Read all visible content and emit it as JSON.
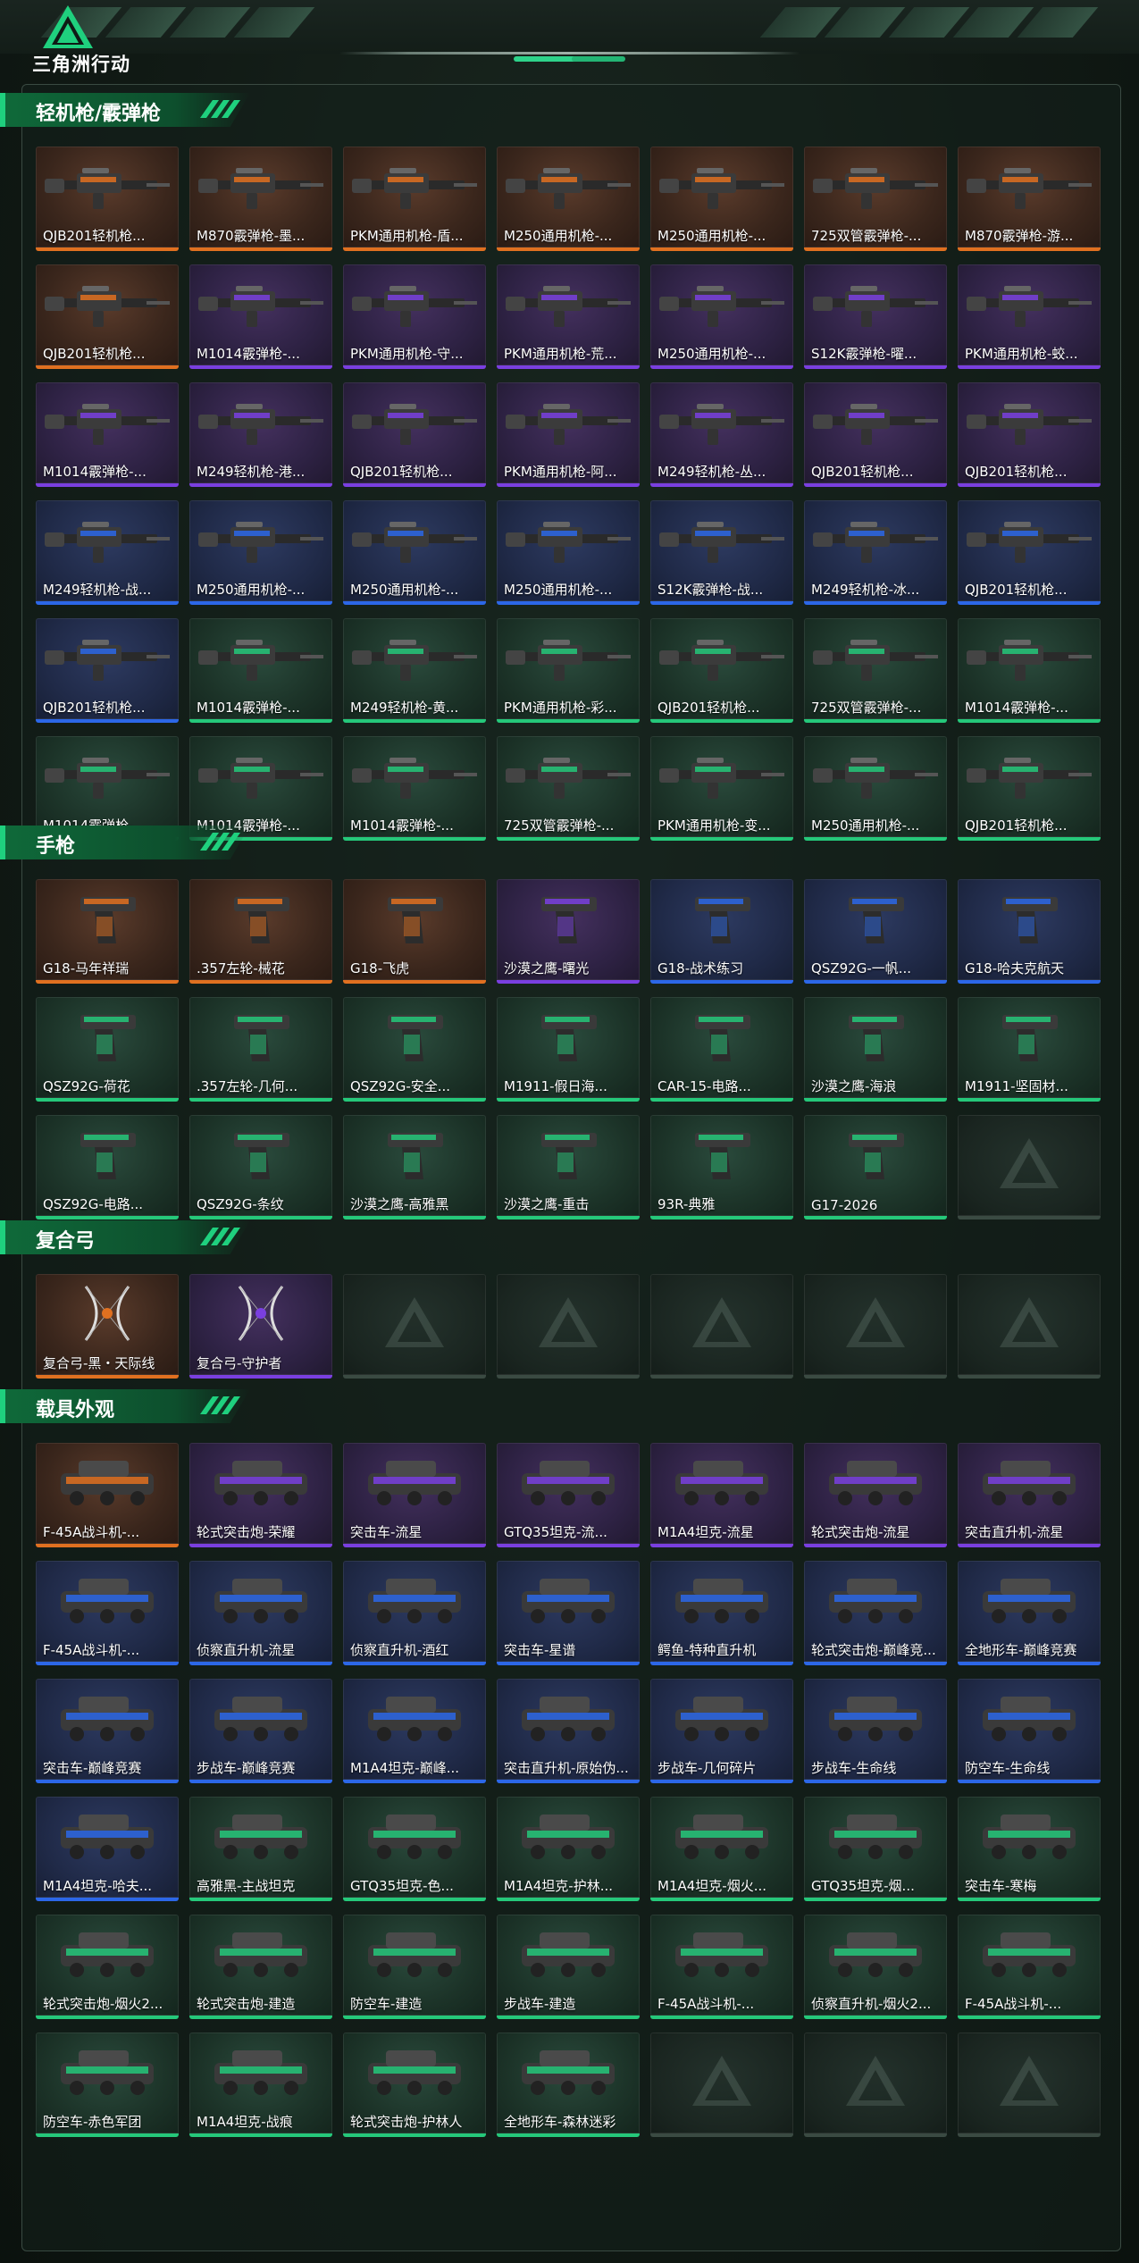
{
  "brand": {
    "name": "三角洲行动",
    "accent": "#1fd07e"
  },
  "colors": {
    "orange": "#e07020",
    "purple": "#7a3fe0",
    "blue": "#2c67e8",
    "green": "#25c87a"
  },
  "sections": [
    {
      "title": "轻机枪/霰弹枪",
      "kind": "gun",
      "items": [
        {
          "label": "QJB201轻机枪...",
          "rarity": "orange"
        },
        {
          "label": "M870霰弹枪-墨...",
          "rarity": "orange"
        },
        {
          "label": "PKM通用机枪-盾...",
          "rarity": "orange"
        },
        {
          "label": "M250通用机枪-...",
          "rarity": "orange"
        },
        {
          "label": "M250通用机枪-...",
          "rarity": "orange"
        },
        {
          "label": "725双管霰弹枪-...",
          "rarity": "orange"
        },
        {
          "label": "M870霰弹枪-游...",
          "rarity": "orange"
        },
        {
          "label": "QJB201轻机枪...",
          "rarity": "orange"
        },
        {
          "label": "M1014霰弹枪-...",
          "rarity": "purple"
        },
        {
          "label": "PKM通用机枪-守...",
          "rarity": "purple"
        },
        {
          "label": "PKM通用机枪-荒...",
          "rarity": "purple"
        },
        {
          "label": "M250通用机枪-...",
          "rarity": "purple"
        },
        {
          "label": "S12K霰弹枪-曜...",
          "rarity": "purple"
        },
        {
          "label": "PKM通用机枪-蛟...",
          "rarity": "purple"
        },
        {
          "label": "M1014霰弹枪-...",
          "rarity": "purple"
        },
        {
          "label": "M249轻机枪-港...",
          "rarity": "purple"
        },
        {
          "label": "QJB201轻机枪...",
          "rarity": "purple"
        },
        {
          "label": "PKM通用机枪-阿...",
          "rarity": "purple"
        },
        {
          "label": "M249轻机枪-丛...",
          "rarity": "purple"
        },
        {
          "label": "QJB201轻机枪...",
          "rarity": "purple"
        },
        {
          "label": "QJB201轻机枪...",
          "rarity": "purple"
        },
        {
          "label": "M249轻机枪-战...",
          "rarity": "blue"
        },
        {
          "label": "M250通用机枪-...",
          "rarity": "blue"
        },
        {
          "label": "M250通用机枪-...",
          "rarity": "blue"
        },
        {
          "label": "M250通用机枪-...",
          "rarity": "blue"
        },
        {
          "label": "S12K霰弹枪-战...",
          "rarity": "blue"
        },
        {
          "label": "M249轻机枪-冰...",
          "rarity": "blue"
        },
        {
          "label": "QJB201轻机枪...",
          "rarity": "blue"
        },
        {
          "label": "QJB201轻机枪...",
          "rarity": "blue"
        },
        {
          "label": "M1014霰弹枪-...",
          "rarity": "green"
        },
        {
          "label": "M249轻机枪-黄...",
          "rarity": "green"
        },
        {
          "label": "PKM通用机枪-彩...",
          "rarity": "green"
        },
        {
          "label": "QJB201轻机枪...",
          "rarity": "green"
        },
        {
          "label": "725双管霰弹枪-...",
          "rarity": "green"
        },
        {
          "label": "M1014霰弹枪-...",
          "rarity": "green"
        },
        {
          "label": "M1014霰弹枪-...",
          "rarity": "green"
        },
        {
          "label": "M1014霰弹枪-...",
          "rarity": "green"
        },
        {
          "label": "M1014霰弹枪-...",
          "rarity": "green"
        },
        {
          "label": "725双管霰弹枪-...",
          "rarity": "green"
        },
        {
          "label": "PKM通用机枪-变...",
          "rarity": "green"
        },
        {
          "label": "M250通用机枪-...",
          "rarity": "green"
        },
        {
          "label": "QJB201轻机枪...",
          "rarity": "green"
        }
      ]
    },
    {
      "title": "手枪",
      "kind": "pistol",
      "items": [
        {
          "label": "G18-马年祥瑞",
          "rarity": "orange"
        },
        {
          "label": ".357左轮-械花",
          "rarity": "orange"
        },
        {
          "label": "G18-飞虎",
          "rarity": "orange"
        },
        {
          "label": "沙漠之鹰-曙光",
          "rarity": "purple"
        },
        {
          "label": "G18-战术练习",
          "rarity": "blue"
        },
        {
          "label": "QSZ92G-一帆...",
          "rarity": "blue"
        },
        {
          "label": "G18-哈夫克航天",
          "rarity": "blue"
        },
        {
          "label": "QSZ92G-荷花",
          "rarity": "green"
        },
        {
          "label": ".357左轮-几何...",
          "rarity": "green"
        },
        {
          "label": "QSZ92G-安全...",
          "rarity": "green"
        },
        {
          "label": "M1911-假日海...",
          "rarity": "green"
        },
        {
          "label": "CAR-15-电路...",
          "rarity": "green"
        },
        {
          "label": "沙漠之鹰-海浪",
          "rarity": "green"
        },
        {
          "label": "M1911-坚固材...",
          "rarity": "green"
        },
        {
          "label": "QSZ92G-电路...",
          "rarity": "green"
        },
        {
          "label": "QSZ92G-条纹",
          "rarity": "green"
        },
        {
          "label": "沙漠之鹰-高雅黑",
          "rarity": "green"
        },
        {
          "label": "沙漠之鹰-重击",
          "rarity": "green"
        },
        {
          "label": "93R-典雅",
          "rarity": "green"
        },
        {
          "label": "G17-2026",
          "rarity": "green"
        },
        {
          "label": "",
          "rarity": "empty"
        }
      ]
    },
    {
      "title": "复合弓",
      "kind": "bow",
      "items": [
        {
          "label": "复合弓-黑・天际线",
          "rarity": "orange"
        },
        {
          "label": "复合弓-守护者",
          "rarity": "purple"
        },
        {
          "label": "",
          "rarity": "empty"
        },
        {
          "label": "",
          "rarity": "empty"
        },
        {
          "label": "",
          "rarity": "empty"
        },
        {
          "label": "",
          "rarity": "empty"
        },
        {
          "label": "",
          "rarity": "empty"
        }
      ]
    },
    {
      "title": "载具外观",
      "kind": "vehicle",
      "items": [
        {
          "label": "F-45A战斗机-...",
          "rarity": "orange"
        },
        {
          "label": "轮式突击炮-荣耀",
          "rarity": "purple"
        },
        {
          "label": "突击车-流星",
          "rarity": "purple"
        },
        {
          "label": "GTQ35坦克-流...",
          "rarity": "purple"
        },
        {
          "label": "M1A4坦克-流星",
          "rarity": "purple"
        },
        {
          "label": "轮式突击炮-流星",
          "rarity": "purple"
        },
        {
          "label": "突击直升机-流星",
          "rarity": "purple"
        },
        {
          "label": "F-45A战斗机-...",
          "rarity": "blue"
        },
        {
          "label": "侦察直升机-流星",
          "rarity": "blue"
        },
        {
          "label": "侦察直升机-酒红",
          "rarity": "blue"
        },
        {
          "label": "突击车-星谱",
          "rarity": "blue"
        },
        {
          "label": "鳄鱼-特种直升机",
          "rarity": "blue"
        },
        {
          "label": "轮式突击炮-巅峰竞...",
          "rarity": "blue"
        },
        {
          "label": "全地形车-巅峰竞赛",
          "rarity": "blue"
        },
        {
          "label": "突击车-巅峰竞赛",
          "rarity": "blue"
        },
        {
          "label": "步战车-巅峰竞赛",
          "rarity": "blue"
        },
        {
          "label": "M1A4坦克-巅峰...",
          "rarity": "blue"
        },
        {
          "label": "突击直升机-原始伪...",
          "rarity": "blue"
        },
        {
          "label": "步战车-几何碎片",
          "rarity": "blue"
        },
        {
          "label": "步战车-生命线",
          "rarity": "blue"
        },
        {
          "label": "防空车-生命线",
          "rarity": "blue"
        },
        {
          "label": "M1A4坦克-哈夫...",
          "rarity": "blue"
        },
        {
          "label": "高雅黑-主战坦克",
          "rarity": "green"
        },
        {
          "label": "GTQ35坦克-色...",
          "rarity": "green"
        },
        {
          "label": "M1A4坦克-护林...",
          "rarity": "green"
        },
        {
          "label": "M1A4坦克-烟火...",
          "rarity": "green"
        },
        {
          "label": "GTQ35坦克-烟...",
          "rarity": "green"
        },
        {
          "label": "突击车-寒梅",
          "rarity": "green"
        },
        {
          "label": "轮式突击炮-烟火2...",
          "rarity": "green"
        },
        {
          "label": "轮式突击炮-建造",
          "rarity": "green"
        },
        {
          "label": "防空车-建造",
          "rarity": "green"
        },
        {
          "label": "步战车-建造",
          "rarity": "green"
        },
        {
          "label": "F-45A战斗机-...",
          "rarity": "green"
        },
        {
          "label": "侦察直升机-烟火2...",
          "rarity": "green"
        },
        {
          "label": "F-45A战斗机-...",
          "rarity": "green"
        },
        {
          "label": "防空车-赤色军团",
          "rarity": "green"
        },
        {
          "label": "M1A4坦克-战痕",
          "rarity": "green"
        },
        {
          "label": "轮式突击炮-护林人",
          "rarity": "green"
        },
        {
          "label": "全地形车-森林迷彩",
          "rarity": "green"
        },
        {
          "label": "",
          "rarity": "empty"
        },
        {
          "label": "",
          "rarity": "empty"
        },
        {
          "label": "",
          "rarity": "empty"
        }
      ]
    }
  ]
}
